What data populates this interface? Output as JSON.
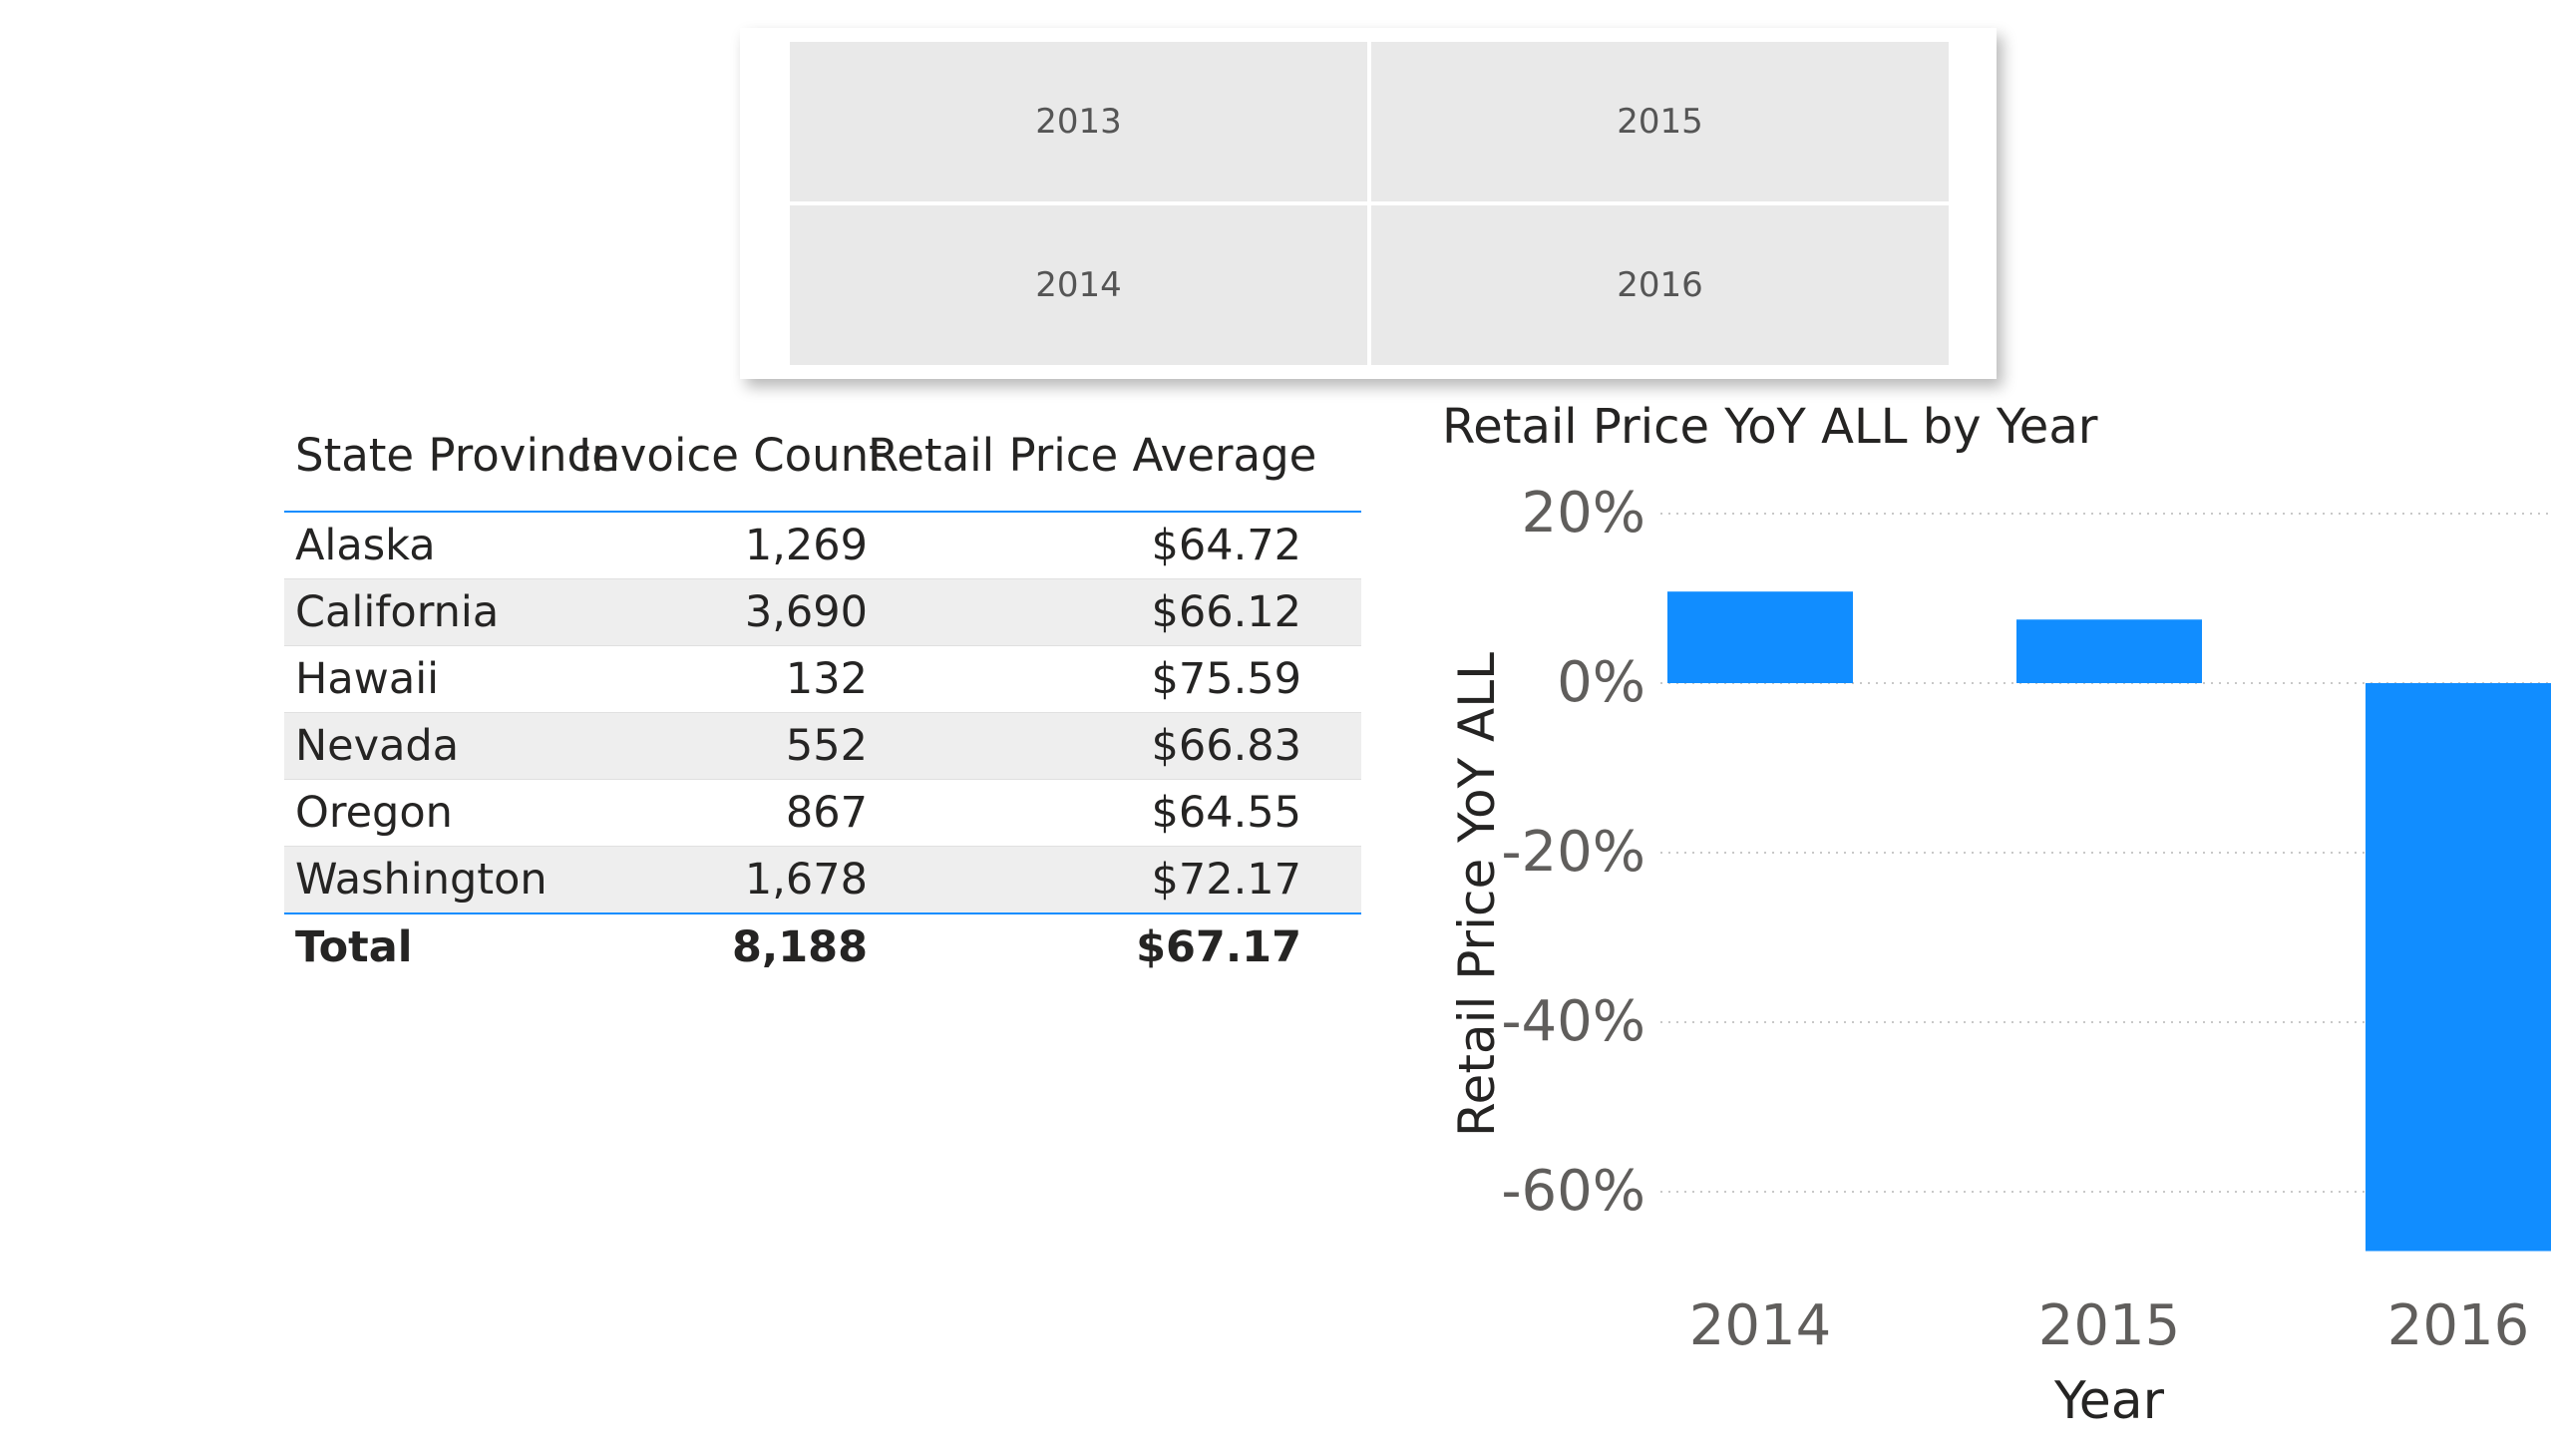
{
  "slicer": {
    "tiles": [
      "2013",
      "2015",
      "2014",
      "2016"
    ]
  },
  "table": {
    "headers": [
      "State Province",
      "Invoice Count",
      "Retail Price Average"
    ],
    "rows": [
      {
        "state": "Alaska",
        "count": "1,269",
        "avg": "$64.72"
      },
      {
        "state": "California",
        "count": "3,690",
        "avg": "$66.12"
      },
      {
        "state": "Hawaii",
        "count": "132",
        "avg": "$75.59"
      },
      {
        "state": "Nevada",
        "count": "552",
        "avg": "$66.83"
      },
      {
        "state": "Oregon",
        "count": "867",
        "avg": "$64.55"
      },
      {
        "state": "Washington",
        "count": "1,678",
        "avg": "$72.17"
      }
    ],
    "total": {
      "label": "Total",
      "count": "8,188",
      "avg": "$67.17"
    }
  },
  "chart_data": {
    "type": "bar",
    "title": "Retail Price YoY ALL by Year",
    "xlabel": "Year",
    "ylabel": "Retail Price YoY ALL",
    "categories": [
      "2014",
      "2015",
      "2016"
    ],
    "values": [
      0.108,
      0.075,
      -0.67
    ],
    "ylim": [
      -0.7,
      0.2
    ],
    "yticks": [
      0.2,
      0,
      -0.2,
      -0.4,
      -0.6
    ],
    "ytick_labels": [
      "20%",
      "0%",
      "-20%",
      "-40%",
      "-60%"
    ],
    "grid": true,
    "bar_color": "#118dff"
  }
}
